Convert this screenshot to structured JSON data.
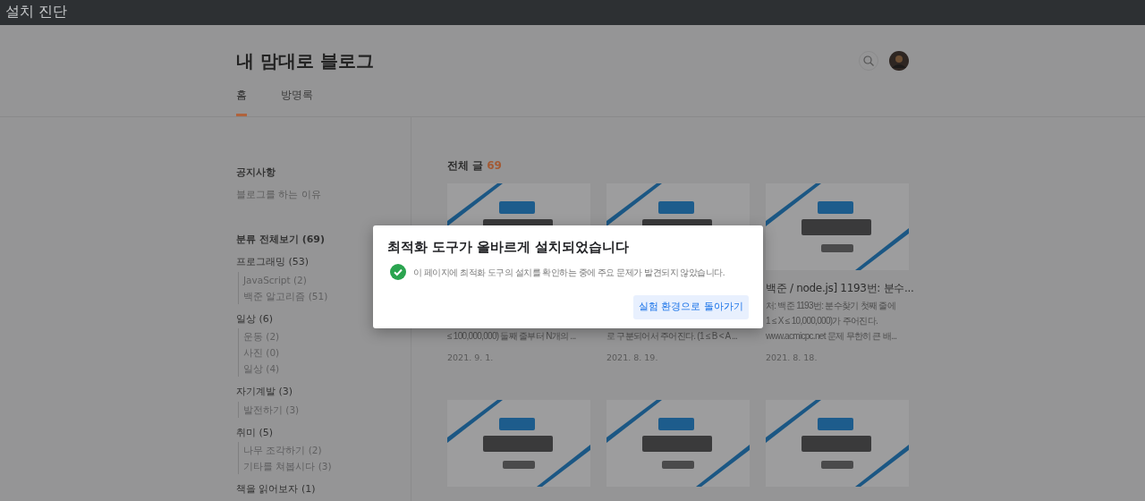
{
  "top_bar": {
    "title": "설치 진단"
  },
  "blog": {
    "title": "내 맘대로 블로그"
  },
  "nav_tabs": [
    {
      "label": "홈",
      "selected": true
    },
    {
      "label": "방명록",
      "selected": false
    }
  ],
  "sidebar": {
    "notice": {
      "heading": "공지사항",
      "items": [
        "블로그를 하는 이유"
      ]
    },
    "categories": {
      "all": "분류 전체보기 (69)",
      "items": [
        {
          "label": "프로그래밍 (53)",
          "children": [
            {
              "label": "JavaScript (2)"
            },
            {
              "label": "백준 알고리즘 (51)"
            }
          ]
        },
        {
          "label": "일상 (6)",
          "children": [
            {
              "label": "운동 (2)"
            },
            {
              "label": "사진 (0)"
            },
            {
              "label": "일상 (4)"
            }
          ]
        },
        {
          "label": "자기계발 (3)",
          "children": [
            {
              "label": "발전하기 (3)"
            }
          ]
        },
        {
          "label": "취미 (5)",
          "children": [
            {
              "label": "나무 조각하기 (2)"
            },
            {
              "label": "기타를 쳐봅시다 (3)"
            }
          ]
        },
        {
          "label": "책을 읽어보자 (1)"
        }
      ]
    }
  },
  "posts": {
    "heading": "전체 글",
    "count": "69",
    "cards": [
      {
        "image": {
          "kind": "picture"
        },
        "lines": [
          "≤ 100,000,000) 둘째 줄부터 N개의 ..."
        ],
        "date": "2021. 9. 1."
      },
      {
        "image": {
          "kind": "picture"
        },
        "lines": [
          "로 구분되어서 주어진다. (1 ≤ B < A ..."
        ],
        "date": "2021. 8. 19."
      },
      {
        "image": {
          "kind": "picture"
        },
        "title": "백준 / node.js] 1193번: 분수...",
        "lines": [
          "처: 백준 1193번: 분수찾기 첫째 줄에",
          "1 ≤ X ≤ 10,000,000)가 주어진다.",
          "www.acmicpc.net 문제 무한히 큰 배..."
        ],
        "date": "2021. 8. 18."
      },
      {
        "image": {
          "kind": "picture"
        }
      },
      {
        "image": {
          "kind": "picture"
        }
      },
      {
        "image": {
          "kind": "picture"
        }
      }
    ]
  },
  "modal": {
    "title": "최적화 도구가 올바르게 설치되었습니다",
    "message": "이 페이지에 최적화 도구의 설치를 확인하는 중에 주요 문제가 발견되지 않았습니다.",
    "button": "실험 환경으로 돌아가기"
  }
}
